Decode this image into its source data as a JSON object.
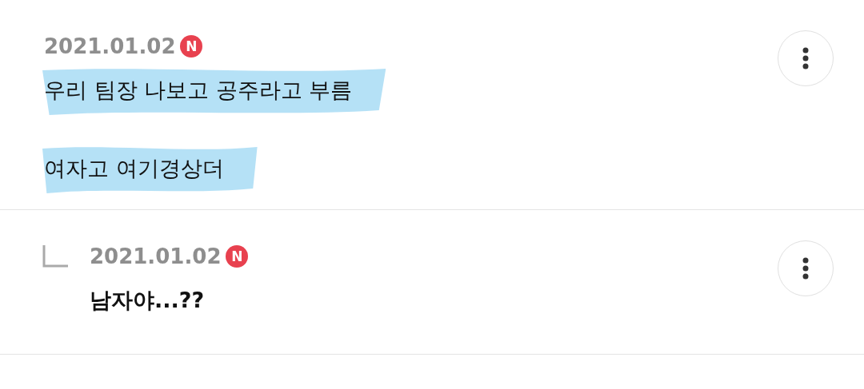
{
  "comments": [
    {
      "kind": "comment",
      "date": "2021.01.02",
      "badge": "N",
      "paragraphs": [
        {
          "text": "우리 팀장 나보고 공주라고 부름",
          "highlighted": true
        },
        {
          "text": "여자고 여기경상더",
          "highlighted": true
        }
      ]
    },
    {
      "kind": "reply",
      "date": "2021.01.02",
      "badge": "N",
      "paragraphs": [
        {
          "text": "남자야...??",
          "highlighted": false
        }
      ]
    }
  ]
}
